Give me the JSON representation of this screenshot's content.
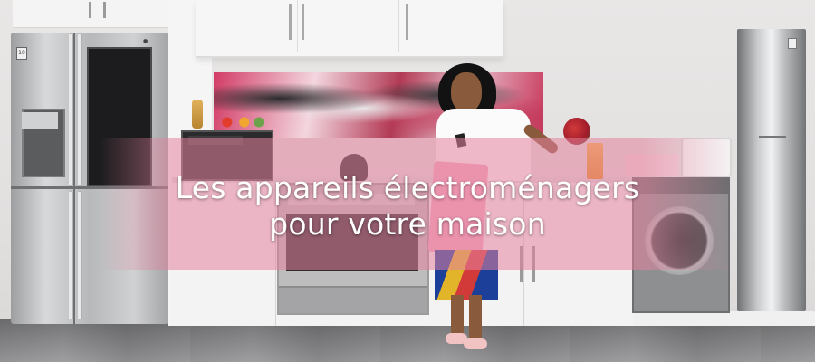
{
  "banner": {
    "line1": "Les appareils électroménagers",
    "line2": "pour votre maison"
  },
  "colors": {
    "banner_overlay": "#e4829e",
    "headline_text": "#ffffff"
  },
  "icons": [
    "lg-logo-icon",
    "energy-badge-icon"
  ]
}
